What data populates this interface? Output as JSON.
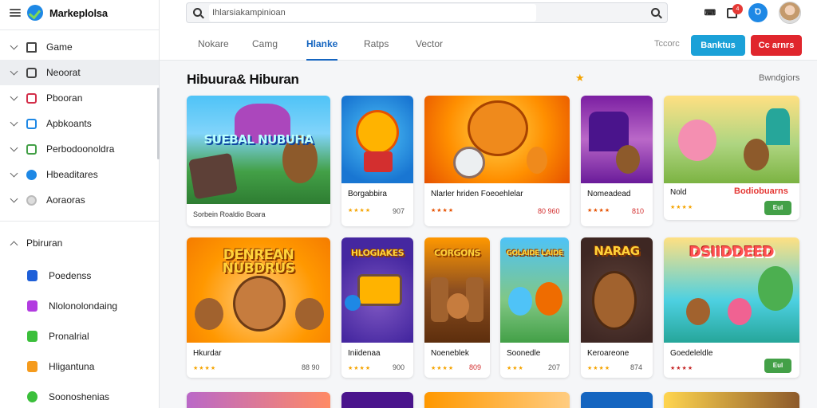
{
  "app": {
    "brand": "Markeplolsa"
  },
  "search": {
    "value": "Ihlarsiakampinioan"
  },
  "topbar": {
    "keyboard_label": "⌨",
    "notif_count": "4",
    "account_initial": "Ꝺ"
  },
  "sidebar": {
    "items": [
      {
        "label": "Game",
        "icon": "home-icon",
        "active": false
      },
      {
        "label": "Neoorat",
        "icon": "square-icon",
        "active": true
      },
      {
        "label": "Pbooran",
        "icon": "red-square-icon",
        "active": false
      },
      {
        "label": "Apbkoants",
        "icon": "blue-square-icon",
        "active": false
      },
      {
        "label": "Perbodoonoldra",
        "icon": "green-square-icon",
        "active": false
      },
      {
        "label": "Hbeaditares",
        "icon": "blue-circle-icon",
        "active": false
      },
      {
        "label": "Aoraoras",
        "icon": "gray-circle-icon",
        "active": false
      }
    ],
    "group": {
      "label": "Pbiruran"
    },
    "sub_items": [
      {
        "label": "Poedenss",
        "color": "#1e5fd8"
      },
      {
        "label": "Nlolonolondaing",
        "color": "#b23be0"
      },
      {
        "label": "Pronalrial",
        "color": "#3bbf3b"
      },
      {
        "label": "Hligantuna",
        "color": "#f59b1d"
      },
      {
        "label": "Soonoshenias",
        "color": "#3bbf3b"
      }
    ]
  },
  "tabs": [
    {
      "label": "Nokare"
    },
    {
      "label": "Camg"
    },
    {
      "label": "Hlanke"
    },
    {
      "label": "Ratps"
    },
    {
      "label": "Vector"
    }
  ],
  "active_tab": "Hlanke",
  "toolbar": {
    "filter_label": "Tccorc",
    "blue_button": "Banktus",
    "red_button": "Cc arnrs"
  },
  "section": {
    "title": "Hibuura& Hiburan",
    "see_all": "Bwndgiors"
  },
  "cards_row1": [
    {
      "thumb_title": "SUEBAL NUBUHA",
      "name": "Sorbein Roaldio Boara",
      "rating": "★★★★",
      "price": ""
    },
    {
      "thumb_title": "",
      "name": "Borgabbira",
      "rating": "★★★★",
      "price": "907"
    },
    {
      "thumb_title": "",
      "name": "Nlarler hriden Foeoehlelar",
      "rating": "★★★★",
      "price": "80 960"
    },
    {
      "thumb_title": "",
      "name": "Nomeadead",
      "rating": "★★★★",
      "price": "810"
    },
    {
      "thumb_title": "",
      "name": "Nold",
      "rating": "★★★★",
      "price": "",
      "highlight": "Bodiobuarns",
      "play": "Eul"
    }
  ],
  "cards_row2": [
    {
      "thumb_title": "DENREAN NUBDRUS",
      "name": "Hkurdar",
      "rating": "★★★★",
      "price": "88 90"
    },
    {
      "thumb_title": "HLOGIAKES",
      "name": "Iniidenaa",
      "rating": "★★★★",
      "price": "900"
    },
    {
      "thumb_title": "CORGONS",
      "name": "Noeneblek",
      "rating": "★★★★",
      "price": "809"
    },
    {
      "thumb_title": "GOLAIDE LAIDE",
      "name": "Soonedle",
      "rating": "★★★",
      "price": "207"
    },
    {
      "thumb_title": "NARAG",
      "name": "Keroareone",
      "rating": "★★★★",
      "price": "874"
    },
    {
      "thumb_title": "DSIIDDEED",
      "name": "Goedeleldle",
      "rating": "★★★★",
      "price": "",
      "play": "Eul"
    }
  ],
  "colors": {
    "accent": "#1565c0",
    "blue_button": "#1ba1d8",
    "red_button": "#e0262d",
    "play": "#43a047",
    "star": "#f4a300"
  }
}
